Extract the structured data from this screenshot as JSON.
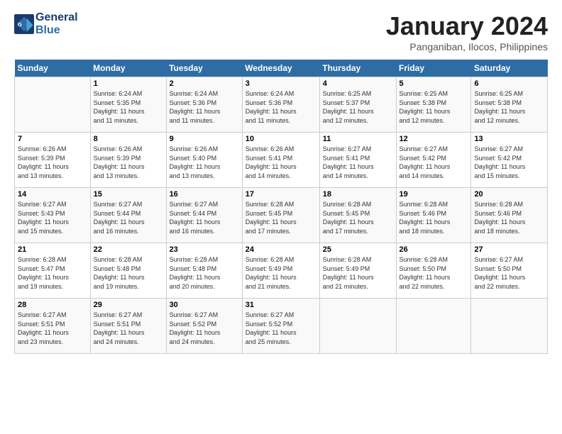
{
  "header": {
    "logo_line1": "General",
    "logo_line2": "Blue",
    "month_title": "January 2024",
    "subtitle": "Panganiban, Ilocos, Philippines"
  },
  "weekdays": [
    "Sunday",
    "Monday",
    "Tuesday",
    "Wednesday",
    "Thursday",
    "Friday",
    "Saturday"
  ],
  "weeks": [
    [
      {
        "day": "",
        "sunrise": "",
        "sunset": "",
        "daylight": ""
      },
      {
        "day": "1",
        "sunrise": "6:24 AM",
        "sunset": "5:35 PM",
        "daylight": "11 hours and 11 minutes."
      },
      {
        "day": "2",
        "sunrise": "6:24 AM",
        "sunset": "5:36 PM",
        "daylight": "11 hours and 11 minutes."
      },
      {
        "day": "3",
        "sunrise": "6:24 AM",
        "sunset": "5:36 PM",
        "daylight": "11 hours and 11 minutes."
      },
      {
        "day": "4",
        "sunrise": "6:25 AM",
        "sunset": "5:37 PM",
        "daylight": "11 hours and 12 minutes."
      },
      {
        "day": "5",
        "sunrise": "6:25 AM",
        "sunset": "5:38 PM",
        "daylight": "11 hours and 12 minutes."
      },
      {
        "day": "6",
        "sunrise": "6:25 AM",
        "sunset": "5:38 PM",
        "daylight": "11 hours and 12 minutes."
      }
    ],
    [
      {
        "day": "7",
        "sunrise": "6:26 AM",
        "sunset": "5:39 PM",
        "daylight": "11 hours and 13 minutes."
      },
      {
        "day": "8",
        "sunrise": "6:26 AM",
        "sunset": "5:39 PM",
        "daylight": "11 hours and 13 minutes."
      },
      {
        "day": "9",
        "sunrise": "6:26 AM",
        "sunset": "5:40 PM",
        "daylight": "11 hours and 13 minutes."
      },
      {
        "day": "10",
        "sunrise": "6:26 AM",
        "sunset": "5:41 PM",
        "daylight": "11 hours and 14 minutes."
      },
      {
        "day": "11",
        "sunrise": "6:27 AM",
        "sunset": "5:41 PM",
        "daylight": "11 hours and 14 minutes."
      },
      {
        "day": "12",
        "sunrise": "6:27 AM",
        "sunset": "5:42 PM",
        "daylight": "11 hours and 14 minutes."
      },
      {
        "day": "13",
        "sunrise": "6:27 AM",
        "sunset": "5:42 PM",
        "daylight": "11 hours and 15 minutes."
      }
    ],
    [
      {
        "day": "14",
        "sunrise": "6:27 AM",
        "sunset": "5:43 PM",
        "daylight": "11 hours and 15 minutes."
      },
      {
        "day": "15",
        "sunrise": "6:27 AM",
        "sunset": "5:44 PM",
        "daylight": "11 hours and 16 minutes."
      },
      {
        "day": "16",
        "sunrise": "6:27 AM",
        "sunset": "5:44 PM",
        "daylight": "11 hours and 16 minutes."
      },
      {
        "day": "17",
        "sunrise": "6:28 AM",
        "sunset": "5:45 PM",
        "daylight": "11 hours and 17 minutes."
      },
      {
        "day": "18",
        "sunrise": "6:28 AM",
        "sunset": "5:45 PM",
        "daylight": "11 hours and 17 minutes."
      },
      {
        "day": "19",
        "sunrise": "6:28 AM",
        "sunset": "5:46 PM",
        "daylight": "11 hours and 18 minutes."
      },
      {
        "day": "20",
        "sunrise": "6:28 AM",
        "sunset": "5:46 PM",
        "daylight": "11 hours and 18 minutes."
      }
    ],
    [
      {
        "day": "21",
        "sunrise": "6:28 AM",
        "sunset": "5:47 PM",
        "daylight": "11 hours and 19 minutes."
      },
      {
        "day": "22",
        "sunrise": "6:28 AM",
        "sunset": "5:48 PM",
        "daylight": "11 hours and 19 minutes."
      },
      {
        "day": "23",
        "sunrise": "6:28 AM",
        "sunset": "5:48 PM",
        "daylight": "11 hours and 20 minutes."
      },
      {
        "day": "24",
        "sunrise": "6:28 AM",
        "sunset": "5:49 PM",
        "daylight": "11 hours and 21 minutes."
      },
      {
        "day": "25",
        "sunrise": "6:28 AM",
        "sunset": "5:49 PM",
        "daylight": "11 hours and 21 minutes."
      },
      {
        "day": "26",
        "sunrise": "6:28 AM",
        "sunset": "5:50 PM",
        "daylight": "11 hours and 22 minutes."
      },
      {
        "day": "27",
        "sunrise": "6:27 AM",
        "sunset": "5:50 PM",
        "daylight": "11 hours and 22 minutes."
      }
    ],
    [
      {
        "day": "28",
        "sunrise": "6:27 AM",
        "sunset": "5:51 PM",
        "daylight": "11 hours and 23 minutes."
      },
      {
        "day": "29",
        "sunrise": "6:27 AM",
        "sunset": "5:51 PM",
        "daylight": "11 hours and 24 minutes."
      },
      {
        "day": "30",
        "sunrise": "6:27 AM",
        "sunset": "5:52 PM",
        "daylight": "11 hours and 24 minutes."
      },
      {
        "day": "31",
        "sunrise": "6:27 AM",
        "sunset": "5:52 PM",
        "daylight": "11 hours and 25 minutes."
      },
      {
        "day": "",
        "sunrise": "",
        "sunset": "",
        "daylight": ""
      },
      {
        "day": "",
        "sunrise": "",
        "sunset": "",
        "daylight": ""
      },
      {
        "day": "",
        "sunrise": "",
        "sunset": "",
        "daylight": ""
      }
    ]
  ],
  "labels": {
    "sunrise_prefix": "Sunrise: ",
    "sunset_prefix": "Sunset: ",
    "daylight_prefix": "Daylight: "
  }
}
